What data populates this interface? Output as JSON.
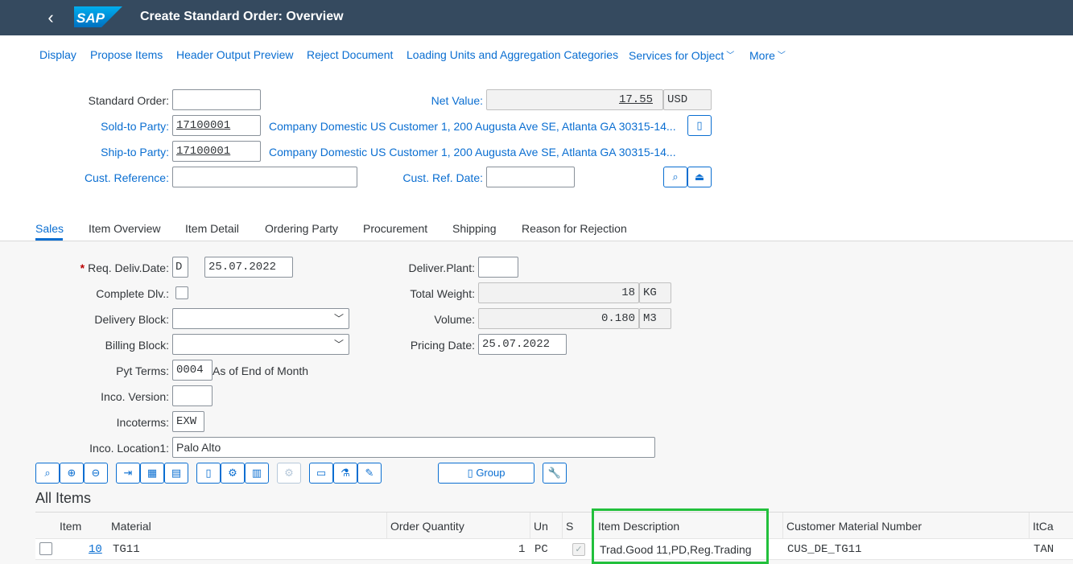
{
  "shell": {
    "back": "‹",
    "logo": "SAP",
    "title": "Create Standard Order: Overview"
  },
  "toolbar": {
    "display": "Display",
    "propose_items": "Propose Items",
    "header_output_preview": "Header Output Preview",
    "reject_document": "Reject Document",
    "loading_units": "Loading Units and Aggregation Categories",
    "services_for_object": "Services for Object",
    "more": "More"
  },
  "header": {
    "standard_order_label": "Standard Order:",
    "standard_order_value": "",
    "net_value_label": "Net Value:",
    "net_value": "17.55",
    "currency": "USD",
    "sold_to_label": "Sold-to Party:",
    "sold_to_value": "17100001",
    "sold_to_desc": "Company Domestic US Customer 1, 200 Augusta Ave SE, Atlanta GA 30315-14...",
    "ship_to_label": "Ship-to Party:",
    "ship_to_value": "17100001",
    "ship_to_desc": "Company Domestic US Customer 1, 200 Augusta Ave SE, Atlanta GA 30315-14...",
    "cust_ref_label": "Cust. Reference:",
    "cust_ref_value": "",
    "cust_ref_date_label": "Cust. Ref. Date:",
    "cust_ref_date_value": ""
  },
  "tabs": [
    "Sales",
    "Item Overview",
    "Item Detail",
    "Ordering Party",
    "Procurement",
    "Shipping",
    "Reason for Rejection"
  ],
  "sales": {
    "req_deliv_label": "Req. Deliv.Date:",
    "req_deliv_type": "D",
    "req_deliv_date": "25.07.2022",
    "complete_dlv_label": "Complete Dlv.:",
    "delivery_block_label": "Delivery Block:",
    "delivery_block_value": "",
    "billing_block_label": "Billing Block:",
    "billing_block_value": "",
    "pyt_terms_label": "Pyt Terms:",
    "pyt_terms_value": "0004",
    "pyt_terms_desc": "As of End of Month",
    "inco_version_label": "Inco. Version:",
    "inco_version_value": "",
    "incoterms_label": "Incoterms:",
    "incoterms_value": "EXW",
    "inco_location_label": "Inco. Location1:",
    "inco_location_value": "Palo Alto",
    "deliver_plant_label": "Deliver.Plant:",
    "deliver_plant_value": "",
    "total_weight_label": "Total Weight:",
    "total_weight_value": "18",
    "total_weight_unit": "KG",
    "volume_label": "Volume:",
    "volume_value": "0.180",
    "volume_unit": "M3",
    "pricing_date_label": "Pricing Date:",
    "pricing_date_value": "25.07.2022"
  },
  "item_toolbar": {
    "group_label": "Group"
  },
  "items": {
    "title": "All Items",
    "columns": [
      "Item",
      "Material",
      "Order Quantity",
      "Un",
      "S",
      "Item Description",
      "Customer Material Number",
      "ItCa"
    ],
    "rows": [
      {
        "item": "10",
        "material": "TG11",
        "quantity": "1",
        "unit": "PC",
        "desc": "Trad.Good 11,PD,Reg.Trading",
        "cust_mat": "CUS_DE_TG11",
        "itca": "TAN"
      }
    ]
  },
  "colors": {
    "shell": "#354a5f",
    "link": "#0a6ed1",
    "highlight": "#22c03c"
  }
}
